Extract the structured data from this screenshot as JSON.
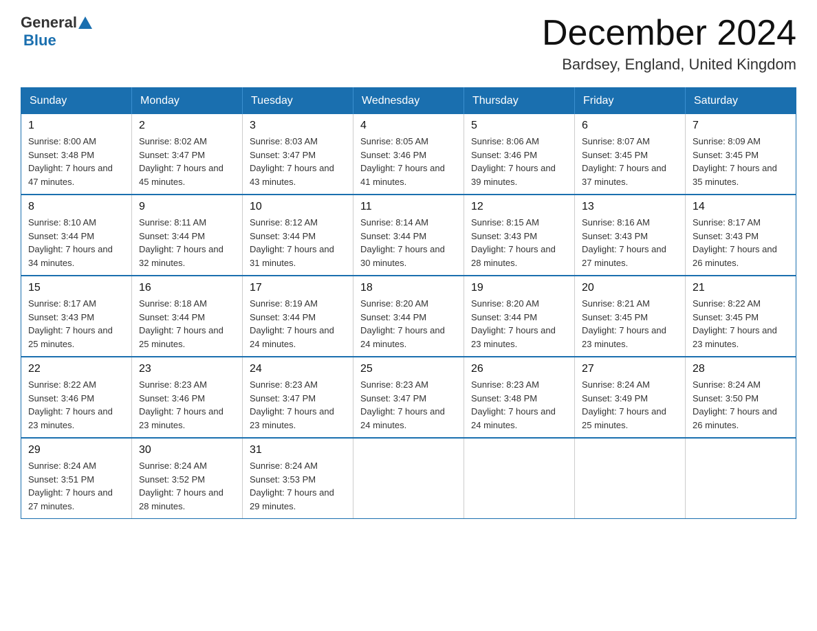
{
  "header": {
    "logo_general": "General",
    "logo_blue": "Blue",
    "month_title": "December 2024",
    "location": "Bardsey, England, United Kingdom"
  },
  "days_of_week": [
    "Sunday",
    "Monday",
    "Tuesday",
    "Wednesday",
    "Thursday",
    "Friday",
    "Saturday"
  ],
  "weeks": [
    [
      {
        "day": "1",
        "sunrise": "8:00 AM",
        "sunset": "3:48 PM",
        "daylight": "7 hours and 47 minutes."
      },
      {
        "day": "2",
        "sunrise": "8:02 AM",
        "sunset": "3:47 PM",
        "daylight": "7 hours and 45 minutes."
      },
      {
        "day": "3",
        "sunrise": "8:03 AM",
        "sunset": "3:47 PM",
        "daylight": "7 hours and 43 minutes."
      },
      {
        "day": "4",
        "sunrise": "8:05 AM",
        "sunset": "3:46 PM",
        "daylight": "7 hours and 41 minutes."
      },
      {
        "day": "5",
        "sunrise": "8:06 AM",
        "sunset": "3:46 PM",
        "daylight": "7 hours and 39 minutes."
      },
      {
        "day": "6",
        "sunrise": "8:07 AM",
        "sunset": "3:45 PM",
        "daylight": "7 hours and 37 minutes."
      },
      {
        "day": "7",
        "sunrise": "8:09 AM",
        "sunset": "3:45 PM",
        "daylight": "7 hours and 35 minutes."
      }
    ],
    [
      {
        "day": "8",
        "sunrise": "8:10 AM",
        "sunset": "3:44 PM",
        "daylight": "7 hours and 34 minutes."
      },
      {
        "day": "9",
        "sunrise": "8:11 AM",
        "sunset": "3:44 PM",
        "daylight": "7 hours and 32 minutes."
      },
      {
        "day": "10",
        "sunrise": "8:12 AM",
        "sunset": "3:44 PM",
        "daylight": "7 hours and 31 minutes."
      },
      {
        "day": "11",
        "sunrise": "8:14 AM",
        "sunset": "3:44 PM",
        "daylight": "7 hours and 30 minutes."
      },
      {
        "day": "12",
        "sunrise": "8:15 AM",
        "sunset": "3:43 PM",
        "daylight": "7 hours and 28 minutes."
      },
      {
        "day": "13",
        "sunrise": "8:16 AM",
        "sunset": "3:43 PM",
        "daylight": "7 hours and 27 minutes."
      },
      {
        "day": "14",
        "sunrise": "8:17 AM",
        "sunset": "3:43 PM",
        "daylight": "7 hours and 26 minutes."
      }
    ],
    [
      {
        "day": "15",
        "sunrise": "8:17 AM",
        "sunset": "3:43 PM",
        "daylight": "7 hours and 25 minutes."
      },
      {
        "day": "16",
        "sunrise": "8:18 AM",
        "sunset": "3:44 PM",
        "daylight": "7 hours and 25 minutes."
      },
      {
        "day": "17",
        "sunrise": "8:19 AM",
        "sunset": "3:44 PM",
        "daylight": "7 hours and 24 minutes."
      },
      {
        "day": "18",
        "sunrise": "8:20 AM",
        "sunset": "3:44 PM",
        "daylight": "7 hours and 24 minutes."
      },
      {
        "day": "19",
        "sunrise": "8:20 AM",
        "sunset": "3:44 PM",
        "daylight": "7 hours and 23 minutes."
      },
      {
        "day": "20",
        "sunrise": "8:21 AM",
        "sunset": "3:45 PM",
        "daylight": "7 hours and 23 minutes."
      },
      {
        "day": "21",
        "sunrise": "8:22 AM",
        "sunset": "3:45 PM",
        "daylight": "7 hours and 23 minutes."
      }
    ],
    [
      {
        "day": "22",
        "sunrise": "8:22 AM",
        "sunset": "3:46 PM",
        "daylight": "7 hours and 23 minutes."
      },
      {
        "day": "23",
        "sunrise": "8:23 AM",
        "sunset": "3:46 PM",
        "daylight": "7 hours and 23 minutes."
      },
      {
        "day": "24",
        "sunrise": "8:23 AM",
        "sunset": "3:47 PM",
        "daylight": "7 hours and 23 minutes."
      },
      {
        "day": "25",
        "sunrise": "8:23 AM",
        "sunset": "3:47 PM",
        "daylight": "7 hours and 24 minutes."
      },
      {
        "day": "26",
        "sunrise": "8:23 AM",
        "sunset": "3:48 PM",
        "daylight": "7 hours and 24 minutes."
      },
      {
        "day": "27",
        "sunrise": "8:24 AM",
        "sunset": "3:49 PM",
        "daylight": "7 hours and 25 minutes."
      },
      {
        "day": "28",
        "sunrise": "8:24 AM",
        "sunset": "3:50 PM",
        "daylight": "7 hours and 26 minutes."
      }
    ],
    [
      {
        "day": "29",
        "sunrise": "8:24 AM",
        "sunset": "3:51 PM",
        "daylight": "7 hours and 27 minutes."
      },
      {
        "day": "30",
        "sunrise": "8:24 AM",
        "sunset": "3:52 PM",
        "daylight": "7 hours and 28 minutes."
      },
      {
        "day": "31",
        "sunrise": "8:24 AM",
        "sunset": "3:53 PM",
        "daylight": "7 hours and 29 minutes."
      },
      null,
      null,
      null,
      null
    ]
  ],
  "labels": {
    "sunrise_prefix": "Sunrise: ",
    "sunset_prefix": "Sunset: ",
    "daylight_prefix": "Daylight: "
  }
}
